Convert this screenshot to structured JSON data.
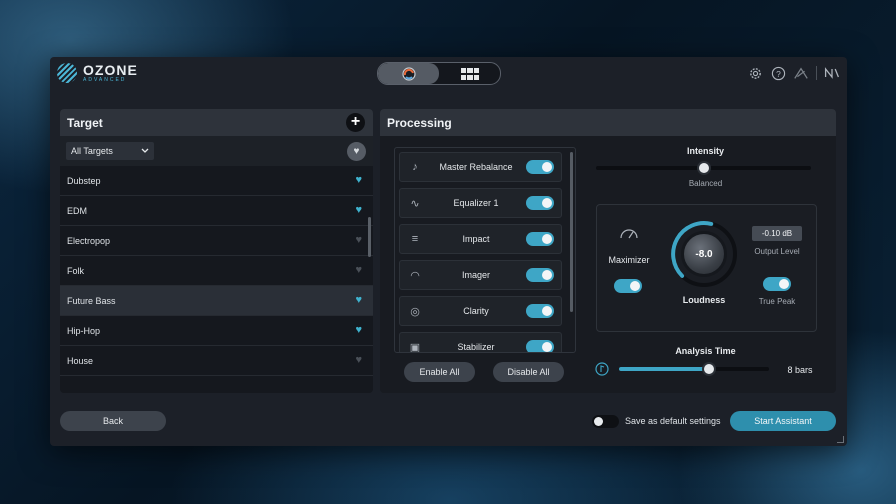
{
  "app": {
    "title": "OZONE",
    "subtitle": "ADVANCED"
  },
  "header": {
    "view_switch": [
      {
        "icon": "assistant-icon",
        "active": true
      },
      {
        "icon": "modules-icon",
        "active": false
      }
    ],
    "icons": [
      "gear-icon",
      "help-icon",
      "ni-connect-icon",
      "ni-logo-icon"
    ],
    "ni_text": "N"
  },
  "target": {
    "title": "Target",
    "add_label": "+",
    "filter": {
      "selected": "All Targets"
    },
    "genres": [
      {
        "label": "Dubstep",
        "favorite": true,
        "selected": false
      },
      {
        "label": "EDM",
        "favorite": true,
        "selected": false
      },
      {
        "label": "Electropop",
        "favorite": false,
        "selected": false
      },
      {
        "label": "Folk",
        "favorite": false,
        "selected": false
      },
      {
        "label": "Future Bass",
        "favorite": true,
        "selected": true
      },
      {
        "label": "Hip-Hop",
        "favorite": true,
        "selected": false
      },
      {
        "label": "House",
        "favorite": false,
        "selected": false
      }
    ]
  },
  "processing": {
    "title": "Processing",
    "modules": [
      {
        "label": "Master Rebalance",
        "icon": "master-rebalance-icon",
        "enabled": true
      },
      {
        "label": "Equalizer 1",
        "icon": "equalizer-icon",
        "enabled": true
      },
      {
        "label": "Impact",
        "icon": "impact-icon",
        "enabled": true
      },
      {
        "label": "Imager",
        "icon": "imager-icon",
        "enabled": true
      },
      {
        "label": "Clarity",
        "icon": "clarity-icon",
        "enabled": true
      },
      {
        "label": "Stabilizer",
        "icon": "stabilizer-icon",
        "enabled": true
      }
    ],
    "enable_all_label": "Enable All",
    "disable_all_label": "Disable All",
    "intensity": {
      "title": "Intensity",
      "value_label": "Balanced",
      "position": 0.5
    },
    "maximizer": {
      "label": "Maximizer",
      "enabled": true
    },
    "loudness": {
      "label": "Loudness",
      "value": "-8.0",
      "level": 0.55
    },
    "output_level": {
      "value": "-0.10 dB",
      "label": "Output Level"
    },
    "true_peak": {
      "label": "True Peak",
      "enabled": true
    },
    "analysis_time": {
      "title": "Analysis Time",
      "value_label": "8 bars",
      "position": 0.6
    }
  },
  "footer": {
    "back_label": "Back",
    "save_default_label": "Save as default settings",
    "save_default_enabled": false,
    "start_label": "Start Assistant"
  },
  "colors": {
    "accent": "#3ea6c6",
    "panel": "#15181e",
    "header": "#2e333b"
  }
}
